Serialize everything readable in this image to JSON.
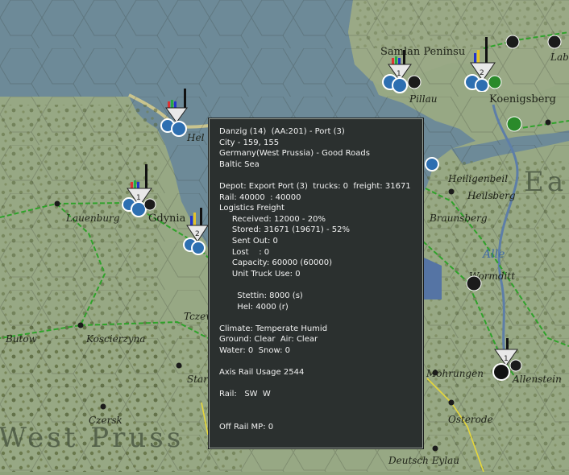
{
  "map": {
    "places": {
      "samland": "Samlan Peninsu",
      "labiau": "Lab",
      "pillau": "Pillau",
      "koenigsberg": "Koenigsberg",
      "hel": "Hel",
      "heiligenbeil": "Heiligenbeil",
      "heilsberg": "Heilsberg",
      "lauenburg": "Lauenburg",
      "gdynia": "Gdynia",
      "braunsberg": "Braunsberg",
      "wormditt": "Wormditt",
      "tczew": "Tczew",
      "butow": "Butow",
      "koscierzyna": "Koscierzyna",
      "starg": "Star",
      "mohrungen": "Mohrungen",
      "allenstein": "Allenstein",
      "czersk": "Czersk",
      "osterode": "Osterode",
      "deutsch_eylau": "Deutsch Eylau"
    },
    "region_labels": {
      "west_prussia": "West Pruss",
      "east": "Ea"
    },
    "river_labels": {
      "alle": "Alle"
    },
    "unit_counts": {
      "samland": "1",
      "koenigsberg": "2",
      "gdynia": "1",
      "danzig": "2",
      "allenstein": "1"
    }
  },
  "info_panel": {
    "lines": [
      "Danzig (14)  (AA:201) - Port (3)",
      "City - 159, 155",
      "Germany(West Prussia) - Good Roads",
      "Baltic Sea",
      "",
      "Depot: Export Port (3)  trucks: 0  freight: 31671",
      "Rail: 40000  : 40000",
      "Logistics Freight",
      "     Received: 12000 - 20%",
      "     Stored: 31671 (19671) - 52%",
      "     Sent Out: 0",
      "     Lost    : 0",
      "     Capacity: 60000 (60000)",
      "     Unit Truck Use: 0",
      "",
      "       Stettin: 8000 (s)",
      "       Hel: 4000 (r)",
      "",
      "Climate: Temperate Humid",
      "Ground: Clear  Air: Clear",
      "Water: 0  Snow: 0",
      "",
      "Axis Rail Usage 2544",
      "",
      "Rail:   SW  W",
      "",
      "",
      "Off Rail MP: 0"
    ]
  }
}
